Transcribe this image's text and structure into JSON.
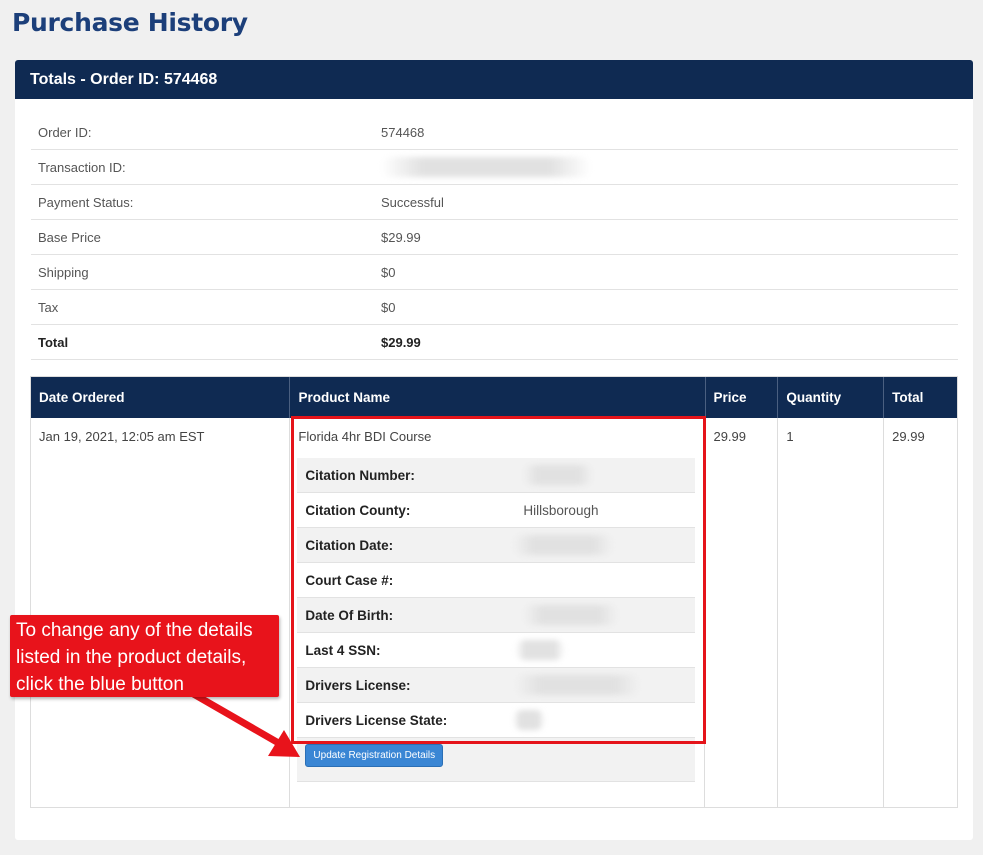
{
  "page": {
    "title": "Purchase History"
  },
  "card": {
    "header": "Totals - Order ID: 574468"
  },
  "totals": [
    {
      "label": "Order ID:",
      "value": "574468"
    },
    {
      "label": "Transaction ID:",
      "value": "",
      "redacted": true
    },
    {
      "label": "Payment Status:",
      "value": "Successful"
    },
    {
      "label": "Base Price",
      "value": "$29.99"
    },
    {
      "label": "Shipping",
      "value": "$0"
    },
    {
      "label": "Tax",
      "value": "$0"
    },
    {
      "label": "Total",
      "value": "$29.99"
    }
  ],
  "orders": {
    "headers": [
      "Date Ordered",
      "Product Name",
      "Price",
      "Quantity",
      "Total"
    ],
    "row": {
      "date": "Jan 19, 2021, 12:05 am EST",
      "product": "Florida 4hr BDI Course",
      "price": "29.99",
      "quantity": "1",
      "total": "29.99"
    },
    "details": [
      {
        "label": "Citation Number:",
        "value": "",
        "redacted": true
      },
      {
        "label": "Citation County:",
        "value": "Hillsborough"
      },
      {
        "label": "Citation Date:",
        "value": "",
        "redacted": true
      },
      {
        "label": "Court Case #:",
        "value": ""
      },
      {
        "label": "Date Of Birth:",
        "value": "",
        "redacted": true
      },
      {
        "label": "Last 4 SSN:",
        "value": "",
        "redacted": true
      },
      {
        "label": "Drivers License:",
        "value": "",
        "redacted": true
      },
      {
        "label": "Drivers License State:",
        "value": "",
        "redacted": true
      }
    ],
    "update_button": "Update Registration Details"
  },
  "annotation": {
    "text_line1": "To change any of the details",
    "text_line2": "listed in the product details,",
    "text_line3": "click the blue button",
    "color": "#e8131b"
  }
}
